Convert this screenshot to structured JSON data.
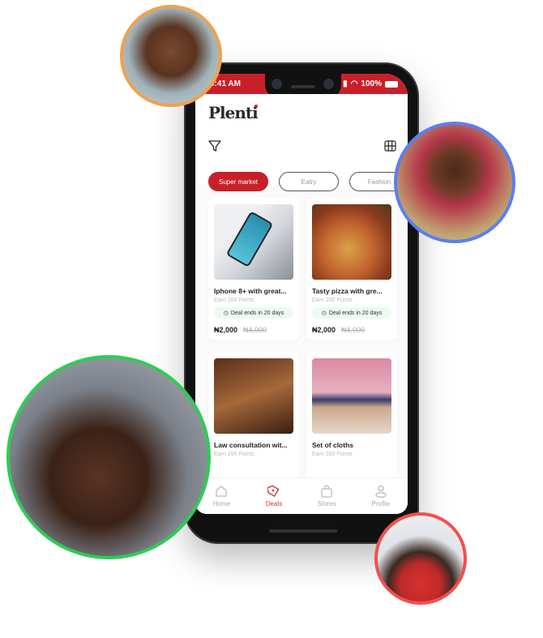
{
  "status": {
    "time": "9:41 AM",
    "battery": "100%"
  },
  "app": {
    "logo": "Plenti"
  },
  "chips": [
    "Super market",
    "Eatry",
    "Fashion"
  ],
  "cards": [
    {
      "title": "Iphone 8+ with great...",
      "points": "Earn 200 Points",
      "deal": "Deal ends in 20 days",
      "price": "₦2,000",
      "old_price": "₦4,000"
    },
    {
      "title": "Tasty pizza with gre...",
      "points": "Earn 200 Points",
      "deal": "Deal ends in 20 days",
      "price": "₦2,000",
      "old_price": "₦4,000"
    },
    {
      "title": "Law consultation wit...",
      "points": "Earn 200 Points"
    },
    {
      "title": "Set of cloths",
      "points": "Earn 200 Points"
    }
  ],
  "nav": [
    "Home",
    "Deals",
    "Stores",
    "Profile"
  ],
  "colors": {
    "brand": "#c8202a",
    "orange": "#f0a050",
    "blue": "#5a7ff0",
    "green": "#2ecc55",
    "red": "#f05050"
  }
}
